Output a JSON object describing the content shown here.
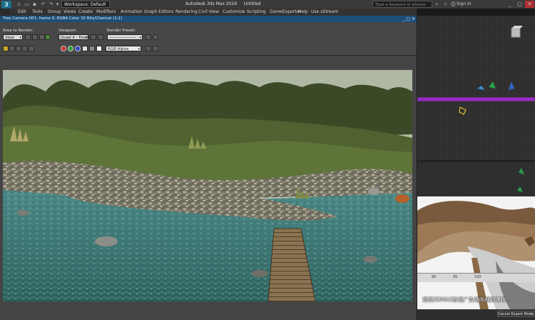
{
  "app": {
    "title": "Autodesk 3ds Max 2016     Untitled",
    "logo_glyph": "3",
    "workspace": "Workspace: Default",
    "search_placeholder": "Type a keyword or phrase",
    "sign_in": "Sign In",
    "window_controls": [
      "_",
      "□",
      "✕"
    ],
    "quick_access_icons": [
      "new-file-icon",
      "open-file-icon",
      "save-icon",
      "undo-icon",
      "redo-icon",
      "project-folder-icon"
    ]
  },
  "menus": [
    "Edit",
    "Tools",
    "Group",
    "Views",
    "Create",
    "Modifiers",
    "Animation",
    "Graph Editors",
    "Rendering",
    "Civil View",
    "Customize",
    "Scripting",
    "GameExporter",
    "Help",
    "Use xStream"
  ],
  "render_window": {
    "title": "Tree Camera 001, frame 0, RGBA Color 32 Bits/Channel (1:1)",
    "area_to_render_label": "Area to Render:",
    "area_to_render_value": "View",
    "viewport_label": "Viewport:",
    "viewport_value": "Quad 4 - Front",
    "render_preset_label": "Render Preset:",
    "render_preset_value": "-------------------",
    "channel_value": "RGB Alpha",
    "swatch_colors": [
      "#d12b2b",
      "#2f9e3a",
      "#2b42c9"
    ]
  },
  "timeline": {
    "ticks": [
      "90",
      "95",
      "100"
    ]
  },
  "watermark": "溜溜3DMAX影视广告动画视频课程",
  "status": {
    "expert_mode": "Cancel Expert Mode"
  }
}
